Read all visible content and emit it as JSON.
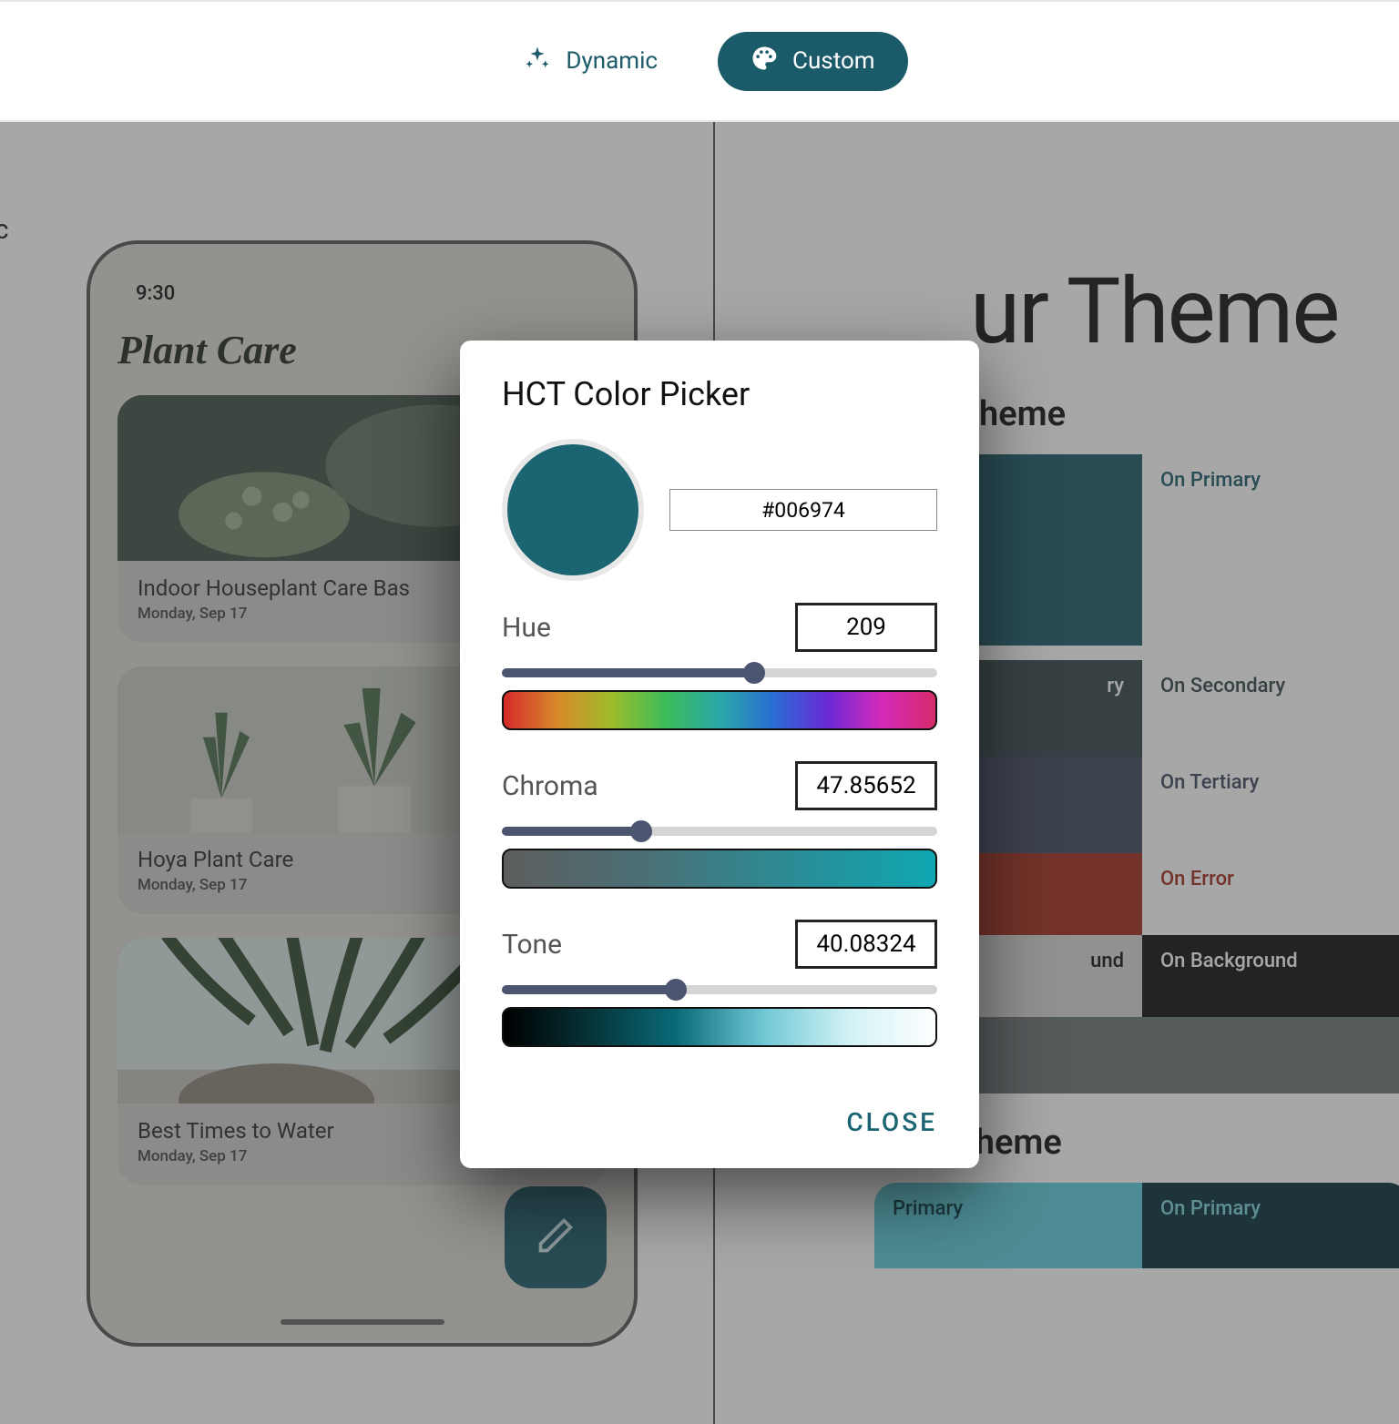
{
  "tabs": {
    "dynamic": "Dynamic",
    "custom": "Custom"
  },
  "left_label": "C",
  "phone": {
    "time": "9:30",
    "title": "Plant Care",
    "cards": [
      {
        "title": "Indoor Houseplant Care Bas",
        "date": "Monday, Sep 17"
      },
      {
        "title": "Hoya Plant Care",
        "date": "Monday, Sep 17"
      },
      {
        "title": "Best Times to Water",
        "date": "Monday, Sep 17"
      }
    ]
  },
  "right": {
    "big_title": "ur Theme",
    "light_heading": "heme",
    "dark_heading": "Dark Theme",
    "swatches": {
      "secondary_partial": "ry",
      "on_primary": "On Primary",
      "on_secondary": "On Secondary",
      "on_tertiary": "On Tertiary",
      "on_error": "On Error",
      "background_partial": "und",
      "on_background": "On Background",
      "dark_primary": "Primary",
      "dark_on_primary": "On Primary"
    }
  },
  "dialog": {
    "title": "HCT Color Picker",
    "hex": "#006974",
    "hue": {
      "label": "Hue",
      "value": "209",
      "percent": 58
    },
    "chroma": {
      "label": "Chroma",
      "value": "47.85652",
      "percent": 32
    },
    "tone": {
      "label": "Tone",
      "value": "40.08324",
      "percent": 40
    },
    "close": "CLOSE",
    "swatch_color": "#1b6573"
  }
}
